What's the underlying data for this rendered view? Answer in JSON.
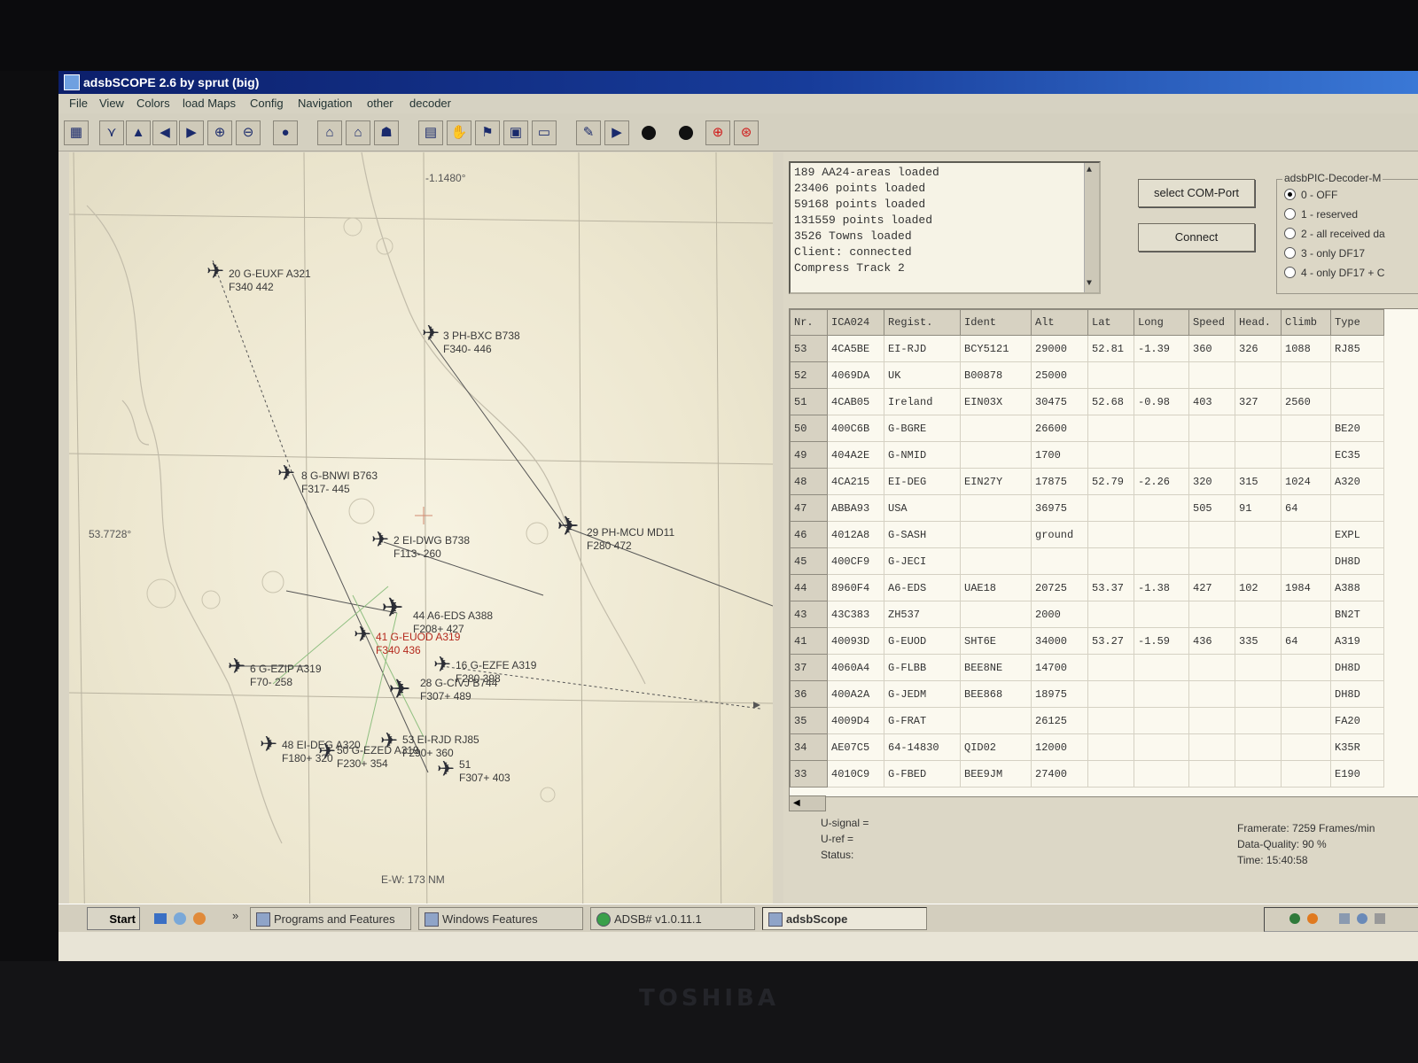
{
  "window": {
    "title": "adsbSCOPE 2.6 by sprut  (big)"
  },
  "menu": [
    "File",
    "View",
    "Colors",
    "load Maps",
    "Config",
    "Navigation",
    "other",
    "decoder"
  ],
  "toolbar_icons": [
    "grid-icon",
    "north-up-icon",
    "north-icon",
    "pan-left-icon",
    "pan-right-icon",
    "zoom-in-icon",
    "zoom-out-icon",
    "globe-icon",
    "airport-a-icon",
    "airport-b-icon",
    "airport-c-icon",
    "table-icon",
    "hand-icon",
    "beacon-icon",
    "notes-icon",
    "monitor-icon",
    "tools-icon",
    "play-icon",
    "record-dot-icon",
    "stop-dot-icon",
    "target-icon",
    "target-alt-icon"
  ],
  "map": {
    "lon_label": "-1.1480°",
    "lat_label": "53.7728°",
    "scale_label": "E-W: 173 NM",
    "aircraft": [
      {
        "line1": "20 G-EUXF A321",
        "line2": "F340  442"
      },
      {
        "line1": "3 PH-BXC B738",
        "line2": "F340- 446"
      },
      {
        "line1": "8 G-BNWI B763",
        "line2": "F317- 445"
      },
      {
        "line1": "2 EI-DWG B738",
        "line2": "F113- 260"
      },
      {
        "line1": "29 PH-MCU MD11",
        "line2": "F280  472"
      },
      {
        "line1": "44 A6-EDS A388",
        "line2": "F208+ 427"
      },
      {
        "line1": "41 G-EUOD A319",
        "line2": "F340  436",
        "red": true
      },
      {
        "line1": "16 G-EZFE A319",
        "line2": "F280  398"
      },
      {
        "line1": "6 G-EZIP A319",
        "line2": "F70-  258"
      },
      {
        "line1": "28 G-CIVJ B744",
        "line2": "F307+ 489"
      },
      {
        "line1": "48 EI-DEG A320",
        "line2": "F180+ 320"
      },
      {
        "line1": "50 G-EZED A319",
        "line2": "F230+ 354"
      },
      {
        "line1": "53 EI-RJD RJ85",
        "line2": "F290+ 360"
      },
      {
        "line1": "51",
        "line2": "F307+ 403"
      }
    ]
  },
  "log": {
    "lines": [
      "189 AA24-areas loaded",
      "23406 points loaded",
      "59168 points loaded",
      "131559 points loaded",
      "3526 Towns loaded",
      "Client: connected",
      "Compress Track 2"
    ]
  },
  "buttons": {
    "select_com": "select COM-Port",
    "connect": "Connect"
  },
  "decoder_mode": {
    "title": "adsbPIC-Decoder-M",
    "options": [
      "0 - OFF",
      "1 - reserved",
      "2 - all received da",
      "3 - only DF17",
      "4 - only DF17 + C"
    ],
    "selected": 0
  },
  "table": {
    "headers": [
      "Nr.",
      "ICA024",
      "Regist.",
      "Ident",
      "Alt",
      "Lat",
      "Long",
      "Speed",
      "Head.",
      "Climb",
      "Type"
    ],
    "rows": [
      [
        "53",
        "4CA5BE",
        "EI-RJD",
        "BCY5121",
        "29000",
        "52.81",
        "-1.39",
        "360",
        "326",
        "1088",
        "RJ85"
      ],
      [
        "52",
        "4069DA",
        "UK",
        "B00878",
        "25000",
        "",
        "",
        "",
        "",
        "",
        ""
      ],
      [
        "51",
        "4CAB05",
        "Ireland",
        "EIN03X",
        "30475",
        "52.68",
        "-0.98",
        "403",
        "327",
        "2560",
        ""
      ],
      [
        "50",
        "400C6B",
        "G-BGRE",
        "",
        "26600",
        "",
        "",
        "",
        "",
        "",
        "BE20"
      ],
      [
        "49",
        "404A2E",
        "G-NMID",
        "",
        "1700",
        "",
        "",
        "",
        "",
        "",
        "EC35"
      ],
      [
        "48",
        "4CA215",
        "EI-DEG",
        "EIN27Y",
        "17875",
        "52.79",
        "-2.26",
        "320",
        "315",
        "1024",
        "A320"
      ],
      [
        "47",
        "ABBA93",
        "USA",
        "",
        "36975",
        "",
        "",
        "505",
        "91",
        "64",
        ""
      ],
      [
        "46",
        "4012A8",
        "G-SASH",
        "",
        "ground",
        "",
        "",
        "",
        "",
        "",
        "EXPL"
      ],
      [
        "45",
        "400CF9",
        "G-JECI",
        "",
        "",
        "",
        "",
        "",
        "",
        "",
        "DH8D"
      ],
      [
        "44",
        "8960F4",
        "A6-EDS",
        "UAE18",
        "20725",
        "53.37",
        "-1.38",
        "427",
        "102",
        "1984",
        "A388"
      ],
      [
        "43",
        "43C383",
        "ZH537",
        "",
        "2000",
        "",
        "",
        "",
        "",
        "",
        "BN2T"
      ],
      [
        "41",
        "40093D",
        "G-EUOD",
        "SHT6E",
        "34000",
        "53.27",
        "-1.59",
        "436",
        "335",
        "64",
        "A319"
      ],
      [
        "37",
        "4060A4",
        "G-FLBB",
        "BEE8NE",
        "14700",
        "",
        "",
        "",
        "",
        "",
        "DH8D"
      ],
      [
        "36",
        "400A2A",
        "G-JEDM",
        "BEE868",
        "18975",
        "",
        "",
        "",
        "",
        "",
        "DH8D"
      ],
      [
        "35",
        "4009D4",
        "G-FRAT",
        "",
        "26125",
        "",
        "",
        "",
        "",
        "",
        "FA20"
      ],
      [
        "34",
        "AE07C5",
        "64-14830",
        "QID02",
        "12000",
        "",
        "",
        "",
        "",
        "",
        "K35R"
      ],
      [
        "33",
        "4010C9",
        "G-FBED",
        "BEE9JM",
        "27400",
        "",
        "",
        "",
        "",
        "",
        "E190"
      ]
    ]
  },
  "status": {
    "u_signal": "U-signal =",
    "u_ref": "U-ref =",
    "status": "Status:",
    "framerate": "Framerate:  7259 Frames/min",
    "quality": "Data-Quality:  90 %",
    "time": "Time: 15:40:58"
  },
  "taskbar": {
    "start": "Start",
    "chevron": "»",
    "tasks": [
      "Programs and Features",
      "Windows Features",
      "ADSB# v1.0.11.1",
      "adsbScope"
    ],
    "active_index": 3
  },
  "monitor_brand": "TOSHIBA"
}
